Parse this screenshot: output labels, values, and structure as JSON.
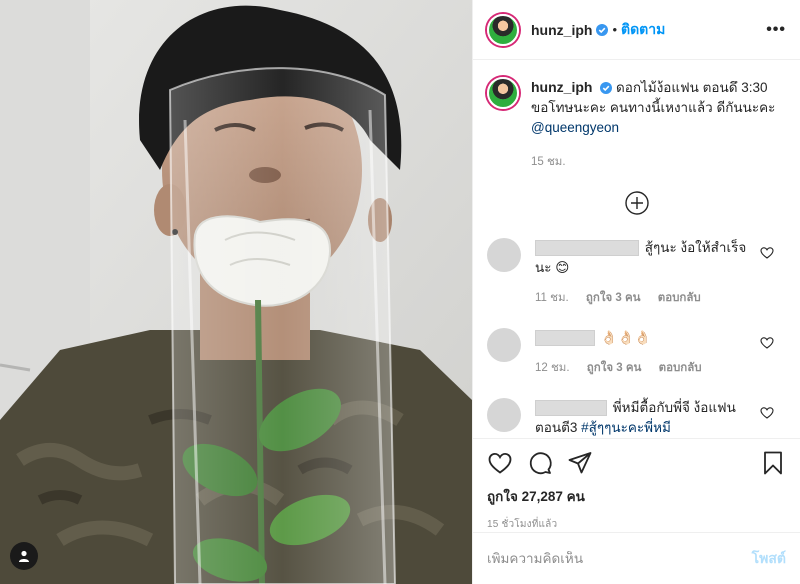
{
  "post": {
    "username": "hunz_iph",
    "follow_label": "ติดตาม",
    "more_label": "•••",
    "caption_text": "ดอกไม้ง้อแฟน ตอนดึ 3:30 ขอโทษนะคะ คนทางนี้เหงาแล้ว ดีกันนะคะ",
    "caption_mention": "@queengyeon",
    "caption_time": "15 ชม.",
    "likes_label": "ถูกใจ 27,287 คน",
    "post_time": "15 ชั่วโมงที่แล้ว"
  },
  "comments": [
    {
      "text": "สู้ๆนะ ง้อให้สำเร็จ นะ",
      "emoji": "😊",
      "time": "11 ชม.",
      "likes": "ถูกใจ 3 คน",
      "reply": "ตอบกลับ"
    },
    {
      "text": "👌🏻👌🏻👌🏻",
      "time": "12 ชม.",
      "likes": "ถูกใจ 3 คน",
      "reply": "ตอบกลับ"
    },
    {
      "text": "พี่หมีตื้อกับพี่จี ง้อแฟน ตอนตี3",
      "hashtag": "#สู้ๆๆนะคะพี่หมี"
    }
  ],
  "add_comment": {
    "placeholder": "เพิ่มความคิดเห็น",
    "post_label": "โพสต์"
  },
  "colors": {
    "link_blue": "#0095f6",
    "mention_blue": "#00376b",
    "muted_gray": "#8e8e8e",
    "verified_blue": "#3897f0"
  },
  "icons": [
    "verified-badge-icon",
    "plus-circle-icon",
    "heart-icon",
    "comment-icon",
    "share-icon",
    "bookmark-icon",
    "user-tag-icon"
  ]
}
